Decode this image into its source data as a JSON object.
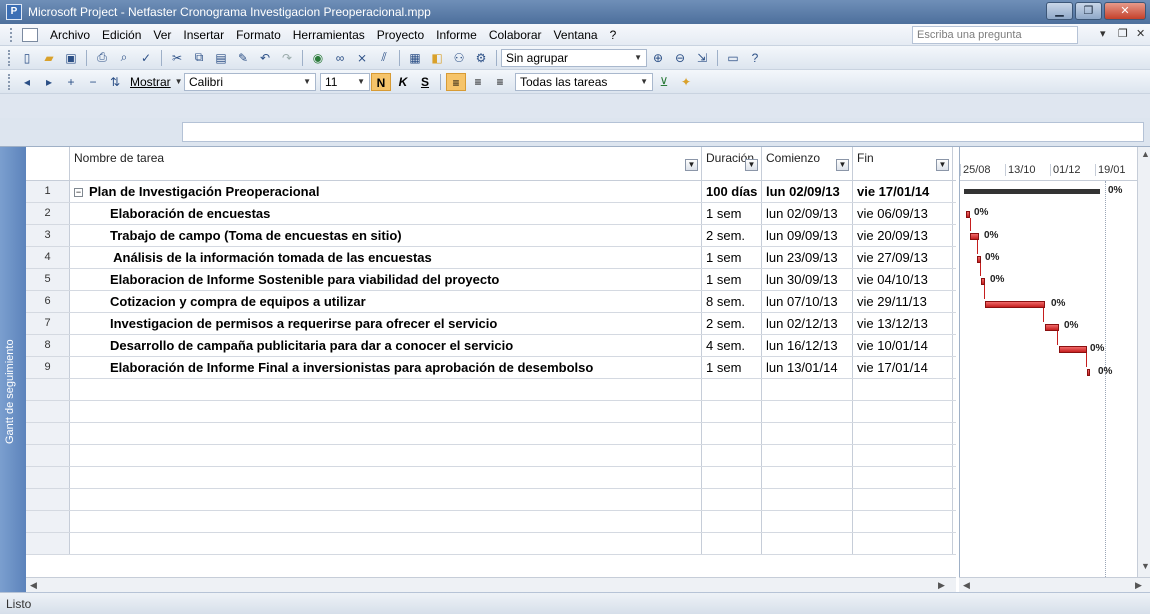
{
  "window": {
    "title": "Microsoft Project - Netfaster Cronograma Investigacion Preoperacional.mpp"
  },
  "menu": {
    "items": [
      "Archivo",
      "Edición",
      "Ver",
      "Insertar",
      "Formato",
      "Herramientas",
      "Proyecto",
      "Informe",
      "Colaborar",
      "Ventana",
      "?"
    ],
    "ask_placeholder": "Escriba una pregunta"
  },
  "toolbar": {
    "group_combo": "Sin agrupar",
    "show_label": "Mostrar",
    "font_combo": "Calibri",
    "size_combo": "11",
    "bold": "N",
    "italic": "K",
    "underline": "S",
    "filter_combo": "Todas las tareas"
  },
  "sidebar_label": "Gantt de seguimiento",
  "table": {
    "headers": [
      "Nombre de tarea",
      "Duración",
      "Comienzo",
      "Fin"
    ],
    "rows": [
      {
        "id": "1",
        "name": "Plan de Investigación Preoperacional",
        "duration": "100 días",
        "start": "lun 02/09/13",
        "end": "vie 17/01/14",
        "summary": true
      },
      {
        "id": "2",
        "name": "Elaboración de encuestas",
        "duration": "1 sem",
        "start": "lun 02/09/13",
        "end": "vie 06/09/13"
      },
      {
        "id": "3",
        "name": "Trabajo de campo (Toma de encuestas en sitio)",
        "duration": "2 sem.",
        "start": "lun 09/09/13",
        "end": "vie 20/09/13"
      },
      {
        "id": "4",
        "name": " Análisis de la información tomada de las encuestas",
        "duration": "1 sem",
        "start": "lun 23/09/13",
        "end": "vie 27/09/13"
      },
      {
        "id": "5",
        "name": "Elaboracion de Informe Sostenible para viabilidad del proyecto",
        "duration": "1 sem",
        "start": "lun 30/09/13",
        "end": "vie 04/10/13"
      },
      {
        "id": "6",
        "name": "Cotizacion y compra de equipos a utilizar",
        "duration": "8 sem.",
        "start": "lun 07/10/13",
        "end": "vie 29/11/13"
      },
      {
        "id": "7",
        "name": "Investigacion de permisos a requerirse para ofrecer el servicio",
        "duration": "2 sem.",
        "start": "lun 02/12/13",
        "end": "vie 13/12/13"
      },
      {
        "id": "8",
        "name": "Desarrollo de campaña publicitaria para dar a conocer el servicio",
        "duration": "4 sem.",
        "start": "lun 16/12/13",
        "end": "vie 10/01/14"
      },
      {
        "id": "9",
        "name": "Elaboración de Informe Final a inversionistas para aprobación de desembolso",
        "duration": "1 sem",
        "start": "lun 13/01/14",
        "end": "vie 17/01/14"
      }
    ]
  },
  "gantt": {
    "timescale": [
      "25/08",
      "13/10",
      "01/12",
      "19/01"
    ],
    "bars": [
      {
        "task": "1",
        "progress": "0%"
      },
      {
        "task": "2",
        "progress": "0%"
      },
      {
        "task": "3",
        "progress": "0%"
      },
      {
        "task": "4",
        "progress": "0%"
      },
      {
        "task": "5",
        "progress": "0%"
      },
      {
        "task": "6",
        "progress": "0%"
      },
      {
        "task": "7",
        "progress": "0%"
      },
      {
        "task": "8",
        "progress": "0%"
      },
      {
        "task": "9",
        "progress": "0%"
      }
    ],
    "bar_color": "#c51e1e"
  },
  "status": "Listo"
}
